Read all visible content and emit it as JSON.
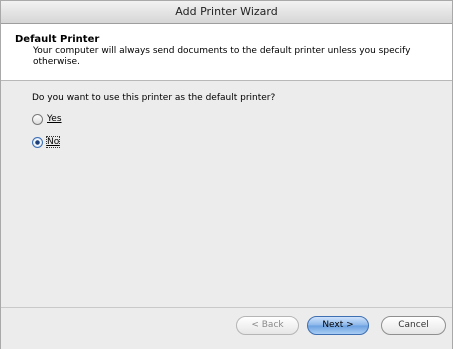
{
  "window": {
    "title": "Add Printer Wizard"
  },
  "header": {
    "title": "Default Printer",
    "description": "Your computer will always send documents to the default printer unless you specify otherwise."
  },
  "body": {
    "question": "Do you want to use this printer as the default printer?",
    "options": [
      {
        "label": "Yes",
        "selected": false
      },
      {
        "label": "No",
        "selected": true
      }
    ]
  },
  "buttons": {
    "back": "< Back",
    "next": "Next >",
    "cancel": "Cancel"
  },
  "colors": {
    "accent": "#6aa0e0",
    "panel": "#ececec"
  }
}
